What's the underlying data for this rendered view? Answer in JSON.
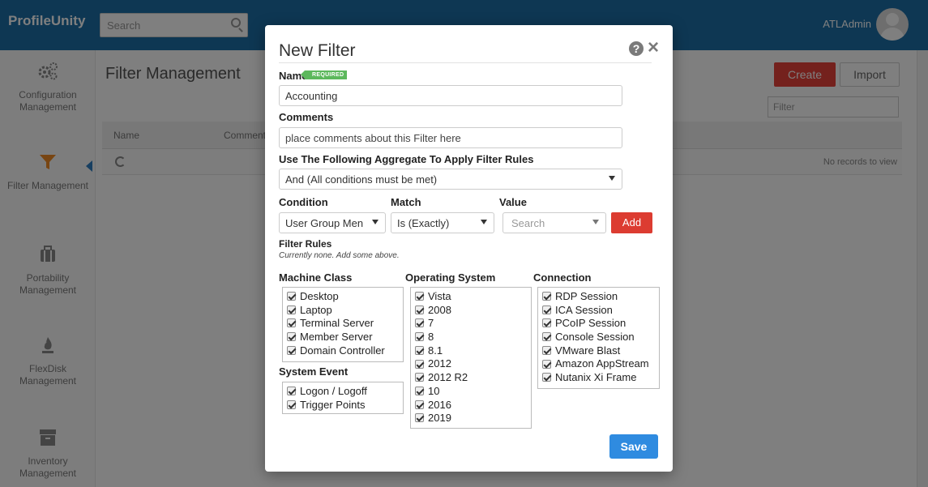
{
  "app": {
    "brand": "ProfileUnity",
    "search_placeholder": "Search",
    "user": "ATLAdmin"
  },
  "sidebar": {
    "items": [
      {
        "label": "Configuration Management",
        "icon": "gears-icon"
      },
      {
        "label": "Filter Management",
        "icon": "funnel-icon",
        "active": true
      },
      {
        "label": "Portability Management",
        "icon": "briefcase-icon"
      },
      {
        "label": "FlexDisk Management",
        "icon": "flame-icon"
      },
      {
        "label": "Inventory Management",
        "icon": "archive-icon"
      }
    ]
  },
  "page": {
    "title": "Filter Management",
    "create_label": "Create",
    "import_label": "Import",
    "filter_placeholder": "Filter",
    "columns": [
      "Name",
      "Comments"
    ],
    "empty_text": "No records to view"
  },
  "modal": {
    "title": "New Filter",
    "name_label": "Name",
    "required_badge": "REQUIRED",
    "name_value": "Accounting",
    "comments_label": "Comments",
    "comments_placeholder": "place comments about this Filter here",
    "aggregate_label": "Use The Following Aggregate To Apply Filter Rules",
    "aggregate_value": "And (All conditions must be met)",
    "condition_label": "Condition",
    "condition_value": "User Group Men",
    "match_label": "Match",
    "match_value": "Is (Exactly)",
    "value_label": "Value",
    "value_placeholder": "Search",
    "add_label": "Add",
    "rules_label": "Filter Rules",
    "rules_hint": "Currently none. Add some above.",
    "machine_class_label": "Machine Class",
    "machine_class": [
      "Desktop",
      "Laptop",
      "Terminal Server",
      "Member Server",
      "Domain Controller"
    ],
    "system_event_label": "System Event",
    "system_event": [
      "Logon / Logoff",
      "Trigger Points"
    ],
    "os_label": "Operating System",
    "os": [
      "Vista",
      "2008",
      "7",
      "8",
      "8.1",
      "2012",
      "2012 R2",
      "10",
      "2016",
      "2019"
    ],
    "connection_label": "Connection",
    "connection": [
      "RDP Session",
      "ICA Session",
      "PCoIP Session",
      "Console Session",
      "VMware Blast",
      "Amazon AppStream",
      "Nutanix Xi Frame"
    ],
    "save_label": "Save"
  },
  "colors": {
    "topbar": "#1d6ea6",
    "danger": "#dc3c31",
    "primary": "#2f8be0",
    "badge": "#5cb85c"
  }
}
